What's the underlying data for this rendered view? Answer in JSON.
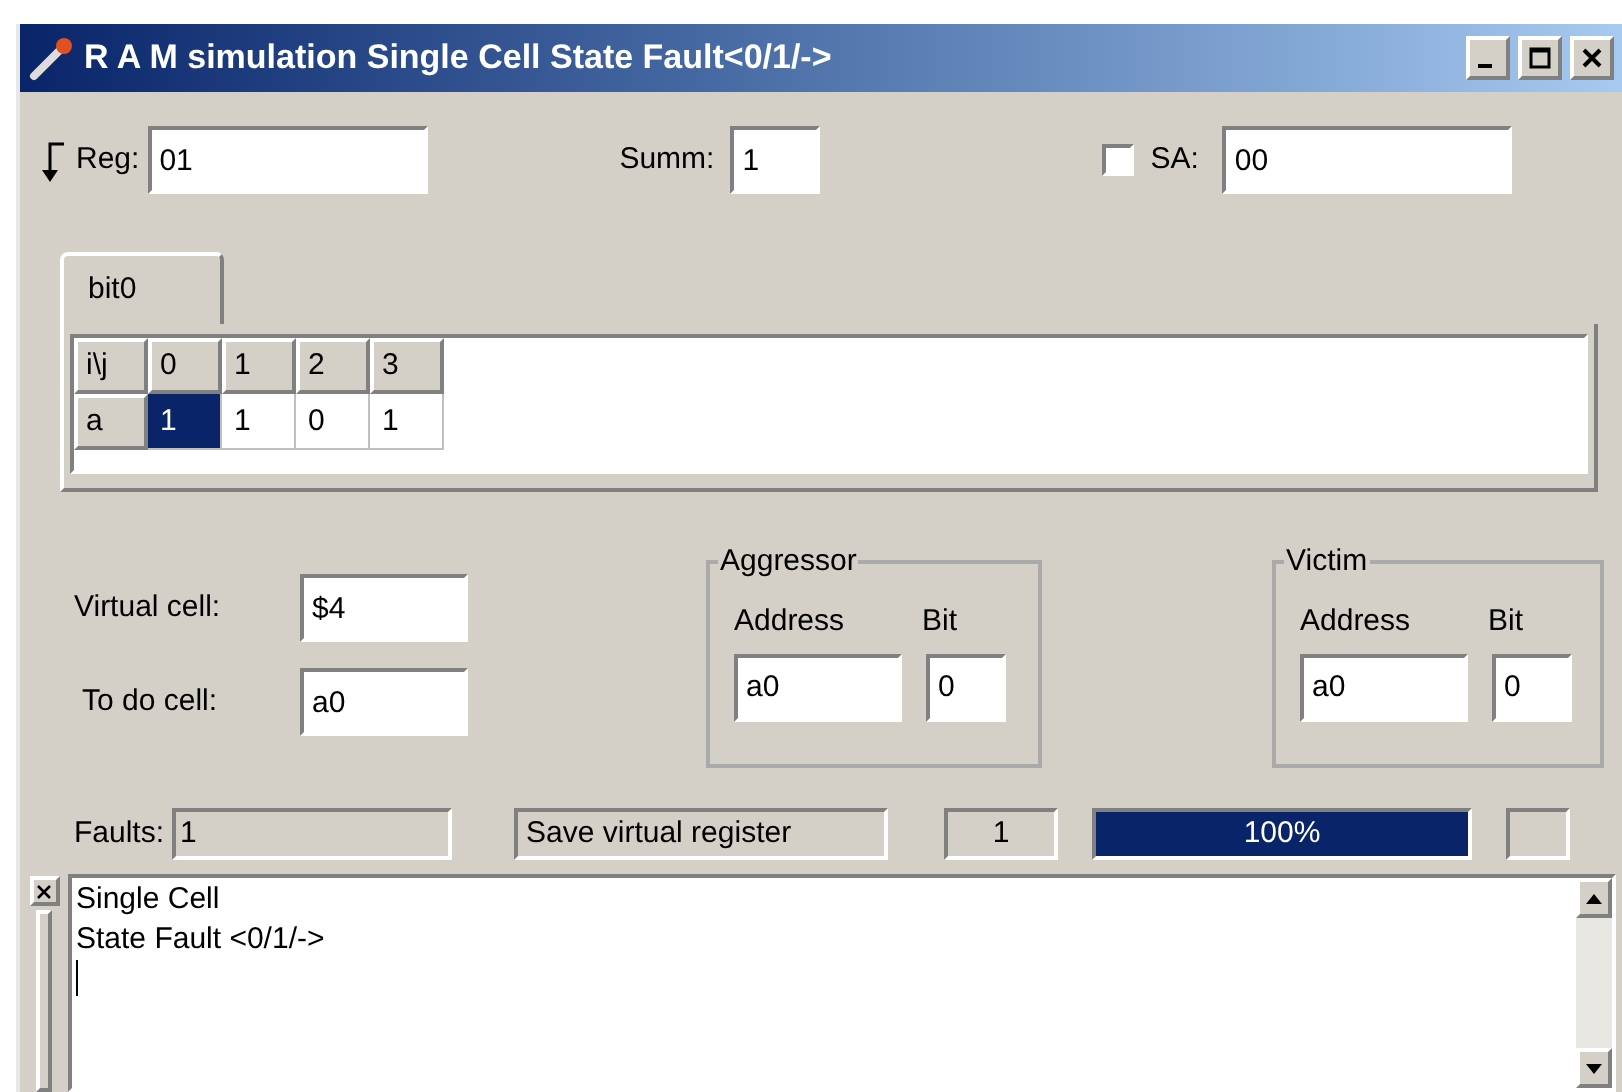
{
  "window": {
    "title": "R A M simulation Single Cell State Fault<0/1/->"
  },
  "reg": {
    "label": "Reg:",
    "value": "01"
  },
  "summ": {
    "label": "Summ:",
    "value": "1"
  },
  "sa": {
    "label": "SA:",
    "checked": false,
    "value": "00"
  },
  "tabs": [
    {
      "label": "bit0",
      "selected": true
    }
  ],
  "grid": {
    "corner": "i\\j",
    "columns": [
      "0",
      "1",
      "2",
      "3"
    ],
    "rows": [
      {
        "label": "a",
        "cells": [
          {
            "value": "1",
            "selected": true
          },
          {
            "value": "1",
            "selected": false
          },
          {
            "value": "0",
            "selected": false
          },
          {
            "value": "1",
            "selected": false
          }
        ]
      }
    ]
  },
  "virtual_cell": {
    "label": "Virtual cell:",
    "value": "$4"
  },
  "to_do_cell": {
    "label": "To do cell:",
    "value": "a0"
  },
  "groups": [
    {
      "legend": "Aggressor",
      "address_label": "Address",
      "bit_label": "Bit",
      "address": "a0",
      "bit": "0"
    },
    {
      "legend": "Victim",
      "address_label": "Address",
      "bit_label": "Bit",
      "address": "a0",
      "bit": "0"
    }
  ],
  "status": {
    "faults_label": "Faults:",
    "faults": "1",
    "save_button": "Save virtual register",
    "counter": "1",
    "progress": {
      "level": 1,
      "reading": "100%"
    }
  },
  "log": {
    "lines": [
      "Single Cell",
      "State Fault <0/1/->"
    ]
  }
}
